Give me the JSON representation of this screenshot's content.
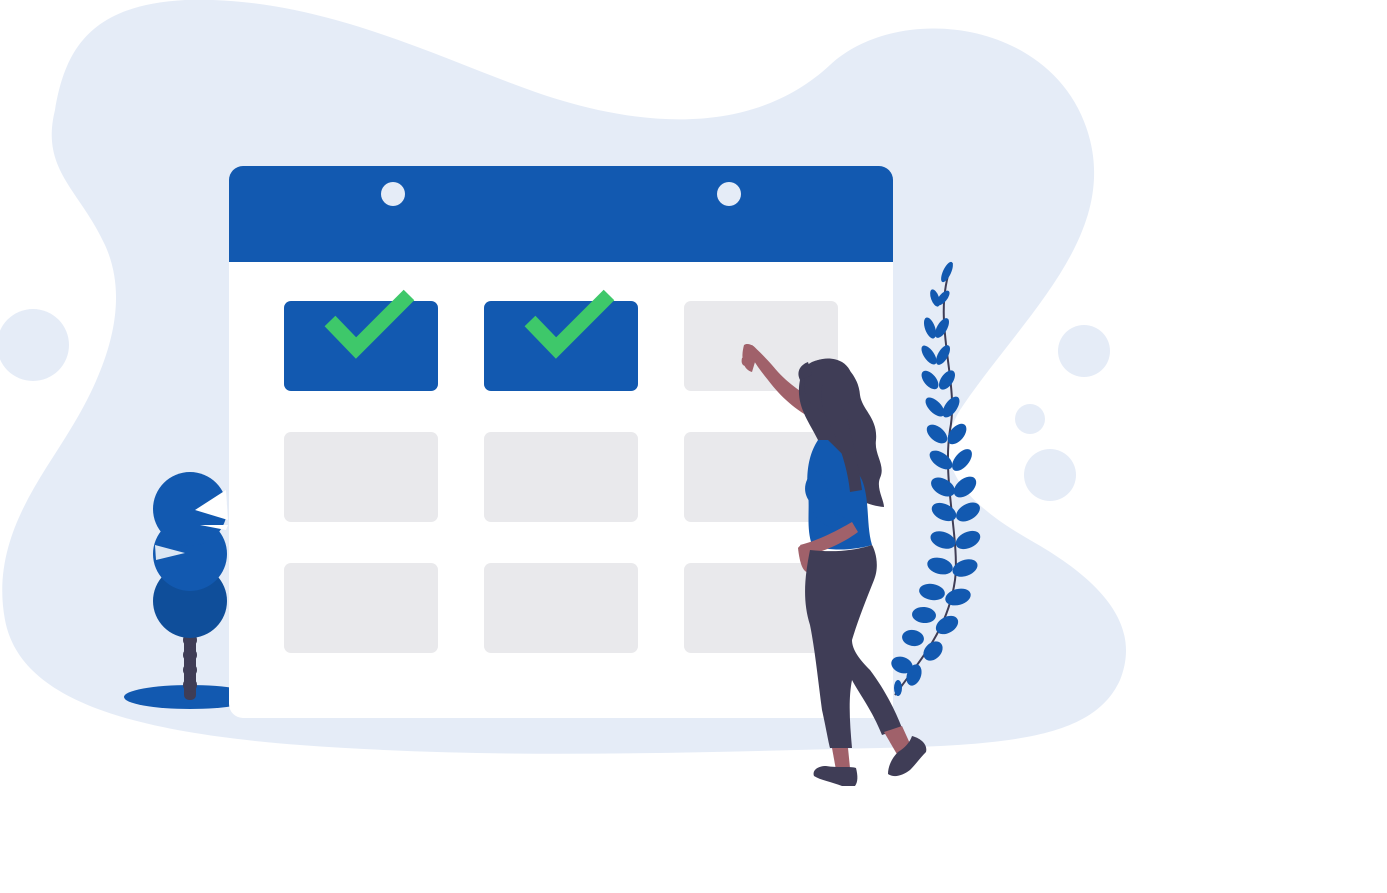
{
  "illustration": {
    "subject": "calendar-schedule",
    "colors": {
      "blob": "#e5ecf7",
      "primary": "#1259b0",
      "check": "#3ec86a",
      "empty_cell": "#e9e9ec",
      "calendar_body": "#ffffff",
      "dark": "#3f3d56",
      "skin": "#a0616a",
      "leaf": "#1259b0"
    },
    "calendar": {
      "rows": 3,
      "columns": 3,
      "completed_cells": [
        {
          "row": 1,
          "col": 1,
          "icon": "check-icon"
        },
        {
          "row": 1,
          "col": 2,
          "icon": "check-icon"
        }
      ],
      "rings": 2
    },
    "elements": [
      "background-blob",
      "decorative-circles",
      "tree",
      "calendar",
      "woman-figure",
      "vine-plant"
    ]
  }
}
